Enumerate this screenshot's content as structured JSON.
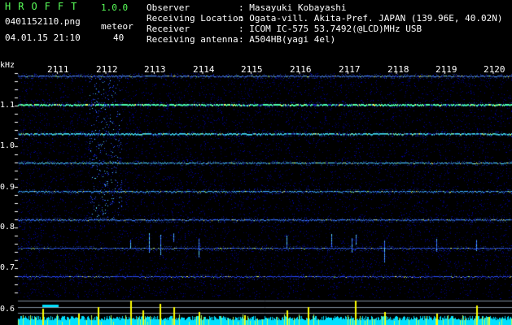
{
  "app": {
    "brand": "HROFFT",
    "version": "1.0.0",
    "filename": "0401152110.png",
    "datetime": "04.01.15 21:10",
    "meteor_label": "meteor",
    "meteor_count": "40"
  },
  "info": {
    "rows": [
      {
        "label": "Observer",
        "value": ": Masayuki Kobayashi"
      },
      {
        "label": "Receiving Location",
        "value": ": Ogata-vill. Akita-Pref. JAPAN (139.96E, 40.02N)"
      },
      {
        "label": "Receiver",
        "value": ": ICOM IC-575 53.7492(@LCD)MHz USB"
      },
      {
        "label": "Receiving antenna",
        "value": ": A504HB(yagi 4el)"
      }
    ]
  },
  "axis": {
    "unit": "kHz",
    "x_ticks": [
      "2111",
      "2112",
      "2113",
      "2114",
      "2115",
      "2116",
      "2117",
      "2118",
      "2119",
      "2120"
    ],
    "y_ticks": [
      "1.1",
      "1.0",
      "0.9",
      "0.8",
      "0.7",
      "0.6"
    ]
  },
  "colors": {
    "background": "#000000",
    "green": "#59ff59",
    "cyan": "#00e0ff",
    "yellow": "#ffff00",
    "blue": "#1a2cff"
  }
}
